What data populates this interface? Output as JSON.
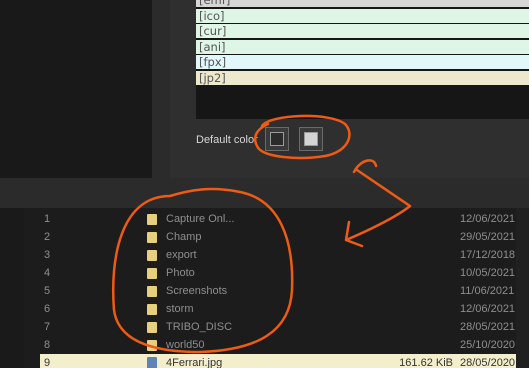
{
  "format_list": {
    "rows": [
      {
        "label": "[emf]",
        "bg": "#d6d6d6"
      },
      {
        "label": "[ico]",
        "bg": "#dff5e6"
      },
      {
        "label": "[cur]",
        "bg": "#dff5e6"
      },
      {
        "label": "[ani]",
        "bg": "#dff5e6"
      },
      {
        "label": "[fpx]",
        "bg": "#e1f7fa"
      },
      {
        "label": "[jp2]",
        "bg": "#ede9cc"
      }
    ]
  },
  "default_color": {
    "label": "Default color",
    "swatches": [
      {
        "name": "dark",
        "color": "#2b2b2b"
      },
      {
        "name": "light",
        "color": "#d4d4d4"
      }
    ]
  },
  "file_list": {
    "rows": [
      {
        "index": "1",
        "name": "Capture Onl...",
        "size": "",
        "date": "12/06/2021",
        "type": "folder"
      },
      {
        "index": "2",
        "name": "Champ",
        "size": "",
        "date": "29/05/2021",
        "type": "folder"
      },
      {
        "index": "3",
        "name": "export",
        "size": "",
        "date": "17/12/2018",
        "type": "folder"
      },
      {
        "index": "4",
        "name": "Photo",
        "size": "",
        "date": "10/05/2021",
        "type": "folder"
      },
      {
        "index": "5",
        "name": "Screenshots",
        "size": "",
        "date": "11/06/2021",
        "type": "folder"
      },
      {
        "index": "6",
        "name": "storm",
        "size": "",
        "date": "12/06/2021",
        "type": "folder"
      },
      {
        "index": "7",
        "name": "TRIBO_DISC",
        "size": "",
        "date": "28/05/2021",
        "type": "folder"
      },
      {
        "index": "8",
        "name": "world50",
        "size": "",
        "date": "25/10/2020",
        "type": "folder"
      },
      {
        "index": "9",
        "name": "4Ferrari.jpg",
        "size": "161.62 KiB",
        "date": "28/05/2020",
        "type": "image",
        "selected": true
      }
    ]
  },
  "colors": {
    "annotation": "#ee5b14",
    "selection": "#f3eecb",
    "folder": "#e6cf7e"
  }
}
